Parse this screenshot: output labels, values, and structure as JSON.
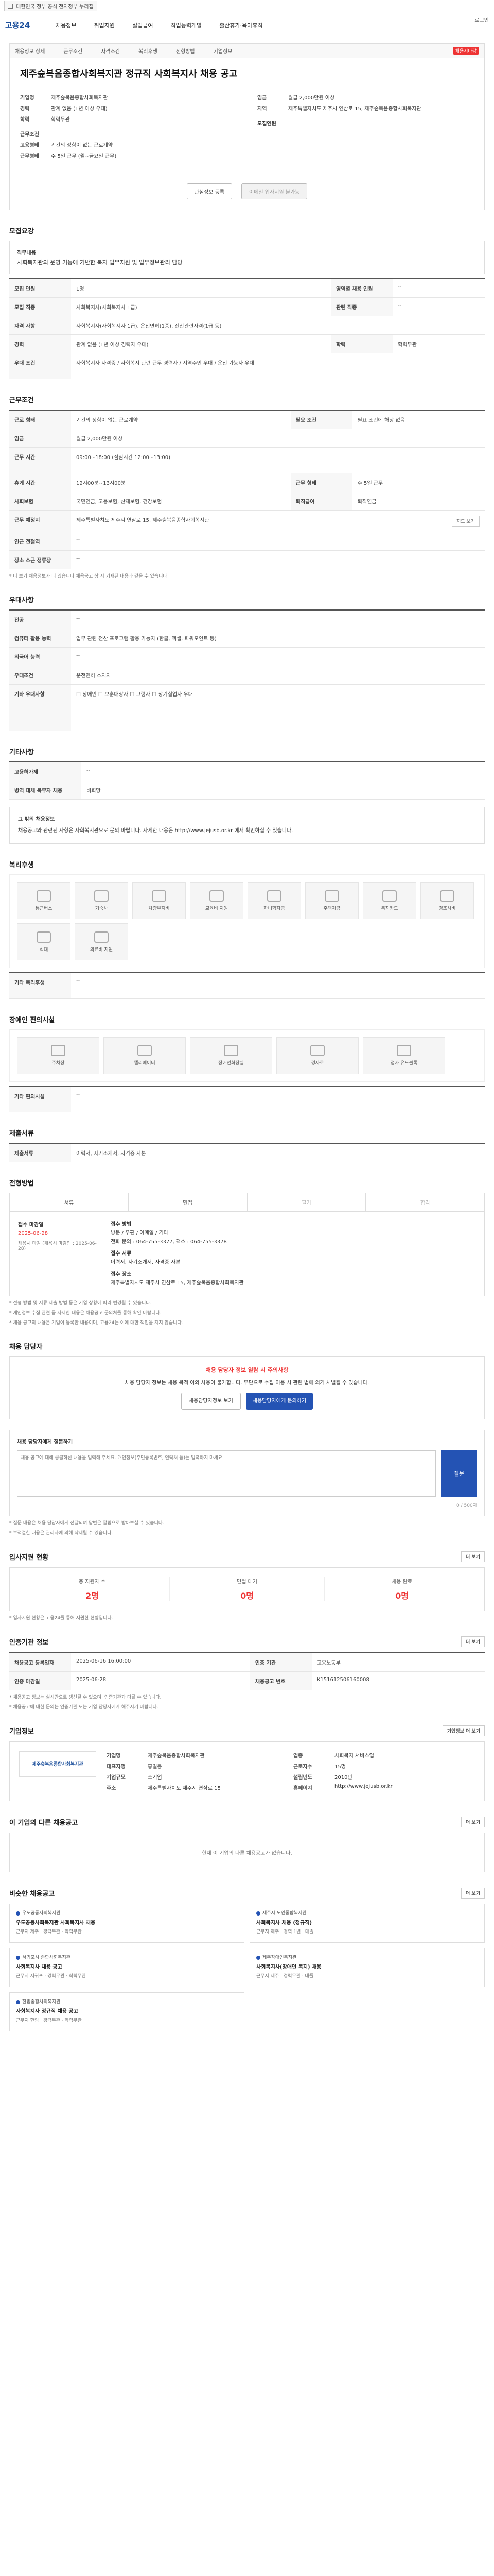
{
  "topbar": {
    "label": "대한민국 정부 공식 전자정부 누리집"
  },
  "gnb": {
    "logo": "고용24",
    "menu": [
      "채용정보",
      "취업지원",
      "실업급여",
      "직업능력개발",
      "출산휴가·육아휴직"
    ],
    "right": "로그인"
  },
  "job": {
    "tabs": [
      "채용정보 상세",
      "근무조건",
      "자격조건",
      "복리후생",
      "전형방법",
      "기업정보"
    ],
    "status_pill": "채용시마감",
    "title": "제주숲복음종합사회복지관 정규직 사회복지사 채용 공고",
    "company_label": "기업명",
    "company_name": "제주숲복음종합사회복지관",
    "left_rows": [
      {
        "k": "경력",
        "v": "관계 없음 (1년 이상 우대)"
      },
      {
        "k": "학력",
        "v": "학력무관"
      }
    ],
    "cond_label": "근무조건",
    "cond_rows": [
      {
        "k": "고용형태",
        "v": "기간의 정함이 없는 근로계약"
      },
      {
        "k": "근무형태",
        "v": "주 5일 근무 (월~금요일 근무)"
      }
    ],
    "right_rows": [
      {
        "k": "임금",
        "v": "월급 2,000만원 이상"
      },
      {
        "k": "지역",
        "v": "제주특별자치도 제주시 연삼로 15, 제주숲복음종합사회복지관"
      }
    ],
    "right_label2": "모집인원",
    "btn_save": "관심정보 등록",
    "btn_apply": "이메일 입사지원 불가능"
  },
  "s1": {
    "title": "모집요강",
    "box1_t": "직무내용",
    "box1_v": "사회복지관의 운영 기능에 기반한 복지 업무지원 및 업무정보관리 담당",
    "rows": [
      {
        "k": "모집 인원",
        "v": "1명",
        "k2": "영역별 채용 인원",
        "v2": "--"
      },
      {
        "k": "모집 직종",
        "v": "사회복지사(사회복지사 1급)",
        "k2": "관련 직종",
        "v2": "--"
      },
      {
        "k": "자격 사항",
        "v": "사회복지사(사회복지사 1급), 운전면허(1종), 전산관련자격(1급 등)"
      },
      {
        "k": "경력",
        "v": "관계 없음 (1년 이상 경력자 우대)",
        "k2": "학력",
        "v2": "학력무관"
      },
      {
        "k": "우대 조건",
        "v": "사회복지사 자격증 / 사회복지 관련 근무 경력자 / 지역주민 우대 / 운전 가능자 우대"
      }
    ]
  },
  "s2": {
    "title": "근무조건",
    "rows": [
      {
        "k": "근로 형태",
        "v": "기간의 정함이 없는 근로계약",
        "k2": "필요 조건",
        "v2": "필요 조건에 해당 없음"
      },
      {
        "k": "임금",
        "v": "월급 2,000만원 이상"
      },
      {
        "k": "근무 시간",
        "v": "09:00~18:00 (점심시간 12:00~13:00)"
      },
      {
        "k": "휴게 시간",
        "v": "12시00분~13시00분",
        "k2": "근무 형태",
        "v2": "주 5일 근무"
      },
      {
        "k": "사회보험",
        "v": "국민연금, 고용보험, 산재보험, 건강보험",
        "k2": "퇴직급여",
        "v2": "퇴직연금"
      },
      {
        "k": "근무 예정지",
        "v": "제주특별자치도 제주시 연삼로 15, 제주숲복음종합사회복지관",
        "btn": "지도 보기"
      },
      {
        "k": "인근 전철역",
        "v": "--"
      },
      {
        "k": "장소 소근 정류장",
        "v": "--"
      }
    ],
    "note": "* 더 보기 채용정보가 더 있습니다 채용공고 상 시 기재된 내용과 같을 수 있습니다"
  },
  "s3": {
    "title": "우대사항",
    "rows": [
      {
        "k": "전공",
        "v": "--"
      },
      {
        "k": "컴퓨터 활용 능력",
        "v": "업무 관련 전산 프로그램 활용 가능자 (한글, 엑셀, 파워포인트 등)"
      },
      {
        "k": "외국어 능력",
        "v": "--"
      },
      {
        "k": "우대조건",
        "v": "운전면허 소지자"
      },
      {
        "k": "기타 우대사항",
        "v": "☐ 장애인  ☐ 보훈대상자  ☐ 고령자  ☐ 장기실업자 우대"
      }
    ]
  },
  "s4": {
    "title": "기타사항",
    "rows": [
      {
        "k": "고용허가제",
        "v": "--"
      },
      {
        "k": "병역 대체 복무자 채용",
        "v": "비희망"
      }
    ],
    "info_t": "그 밖의 채용정보",
    "info_v": "채용공고와 관련된 사항은 사회복지관으로 문의 바랍니다. 자세한 내용은 http://www.jejusb.or.kr 에서 확인하실 수 있습니다."
  },
  "s5": {
    "title": "복리후생",
    "tiles": [
      "통근버스",
      "기숙사",
      "차량유지비",
      "교육비 지원",
      "자녀학자금",
      "주택자금",
      "복지카드",
      "경조사비",
      "식대",
      "의료비 지원"
    ],
    "etc_k": "기타 복리후생",
    "etc_v": "--"
  },
  "s6": {
    "title": "장애인 편의시설",
    "tiles": [
      "주차장",
      "엘리베이터",
      "장애인화장실",
      "경사로",
      "점자 유도블록"
    ],
    "etc_k": "기타 편의시설",
    "etc_v": "--"
  },
  "s7": {
    "title": "제출서류",
    "rows": [
      {
        "k": "제출서류",
        "v": "이력서, 자기소개서, 자격증 사본",
        "k2": "",
        "v2": ""
      }
    ]
  },
  "s8": {
    "title": "전형방법",
    "tabs": [
      "서류",
      "면접",
      "필기",
      "합격"
    ],
    "left_k": "접수 마감일",
    "left_v": "2025-06-28",
    "left_sub": "채용시 마감 (채용시 마감인 : 2025-06-28)",
    "right_rows": [
      "접수 방법",
      "방문 / 우편 / 이메일 / 기타",
      "전화 문의 : 064-755-3377, 팩스 : 064-755-3378",
      "접수 서류",
      "이력서, 자기소개서, 자격증 사본",
      "접수 장소",
      "제주특별자치도 제주시 연삼로 15, 제주숲복음종합사회복지관"
    ],
    "notes": [
      "* 전형 방법 및 서류 제출 방법 등은 기업 상황에 따라 변경될 수 있습니다.",
      "* 개인정보 수집 관련 등 자세한 내용은 채용공고 문의처를 통해 확인 바랍니다.",
      "* 채용 공고의 내용은 기업이 등록한 내용이며, 고용24는 이에 대한 책임을 지지 않습니다."
    ]
  },
  "s9": {
    "title": "채용 담당자",
    "wt": "채용 담당자 정보 열람 시 주의사항",
    "wv": "채용 담당자 정보는 채용 목적 이외 사용이 불가합니다. 무단으로 수집 이용 시 관련 법에 의거 처벌될 수 있습니다.",
    "b1": "채용담당자정보 보기",
    "b2": "채용담당자에게 문의하기"
  },
  "s10": {
    "title": "채용 담당자에게 질문하기",
    "placeholder": "채용 공고에 대해 궁금하신 내용을 입력해 주세요. 개인정보(주민등록번호, 연락처 등)는 입력하지 마세요.",
    "qbtn": "질문",
    "count": "0 / 500자",
    "notes": [
      "* 질문 내용은 채용 담당자에게 전달되며 답변은 알림으로 받아보실 수 있습니다.",
      "* 부적절한 내용은 관리자에 의해 삭제될 수 있습니다."
    ]
  },
  "s11": {
    "title": "입사지원 현황",
    "more": "더 보기",
    "stats": [
      {
        "l": "총 지원자 수",
        "v": "2명"
      },
      {
        "l": "면접 대기",
        "v": "0명"
      },
      {
        "l": "채용 완료",
        "v": "0명"
      }
    ],
    "note": "* 입사지원 현황은 고용24를 통해 지원한 현황입니다."
  },
  "s12": {
    "title": "인증기관 정보",
    "more": "더 보기",
    "rows": [
      {
        "k": "채용공고 등록일자",
        "v": "2025-06-16 16:00:00",
        "k2": "인증 기관",
        "v2": "고용노동부"
      },
      {
        "k": "인증 마감일",
        "v": "2025-06-28",
        "k2": "채용공고 번호",
        "v2": "K151612506160008"
      }
    ],
    "notes": [
      "* 채용공고 정보는 실시간으로 갱신될 수 있으며, 인증기관과 다를 수 있습니다.",
      "* 채용공고에 대한 문의는 인증기관 또는 기업 담당자에게 해주시기 바랍니다."
    ]
  },
  "s13": {
    "title": "기업정보",
    "more": "기업정보 더 보기",
    "logo": "제주숲복음종합사회복지관",
    "info": [
      {
        "k": "기업명",
        "v": "제주숲복음종합사회복지관"
      },
      {
        "k": "업종",
        "v": "사회복지 서비스업"
      },
      {
        "k": "대표자명",
        "v": "홍길동"
      },
      {
        "k": "근로자수",
        "v": "15명"
      },
      {
        "k": "기업규모",
        "v": "소기업"
      },
      {
        "k": "설립년도",
        "v": "2010년"
      },
      {
        "k": "주소",
        "v": "제주특별자치도 제주시 연삼로 15"
      },
      {
        "k": "홈페이지",
        "v": "http://www.jejusb.or.kr"
      }
    ]
  },
  "s14": {
    "title": "이 기업의 다른 채용공고",
    "more": "더 보기",
    "empty": "현재 이 기업의 다른 채용공고가 없습니다."
  },
  "s15": {
    "title": "비슷한 채용공고",
    "more": "더 보기",
    "cards": [
      {
        "co": "우도공동사회복지관",
        "ti": "우도공동사회복지관 사회복지사 채용",
        "mt": "근무지 제주 · 경력무관 · 학력무관"
      },
      {
        "co": "제주시 노인종합복지관",
        "ti": "사회복지사 채용 (정규직)",
        "mt": "근무지 제주 · 경력 1년 · 대졸"
      },
      {
        "co": "서귀포시 종합사회복지관",
        "ti": "사회복지사 채용 공고",
        "mt": "근무지 서귀포 · 경력무관 · 학력무관"
      },
      {
        "co": "제주장애인복지관",
        "ti": "사회복지사(장애인 복지) 채용",
        "mt": "근무지 제주 · 경력무관 · 대졸"
      },
      {
        "co": "한림종합사회복지관",
        "ti": "사회복지사 정규직 채용 공고",
        "mt": "근무지 한림 · 경력무관 · 학력무관"
      }
    ]
  }
}
